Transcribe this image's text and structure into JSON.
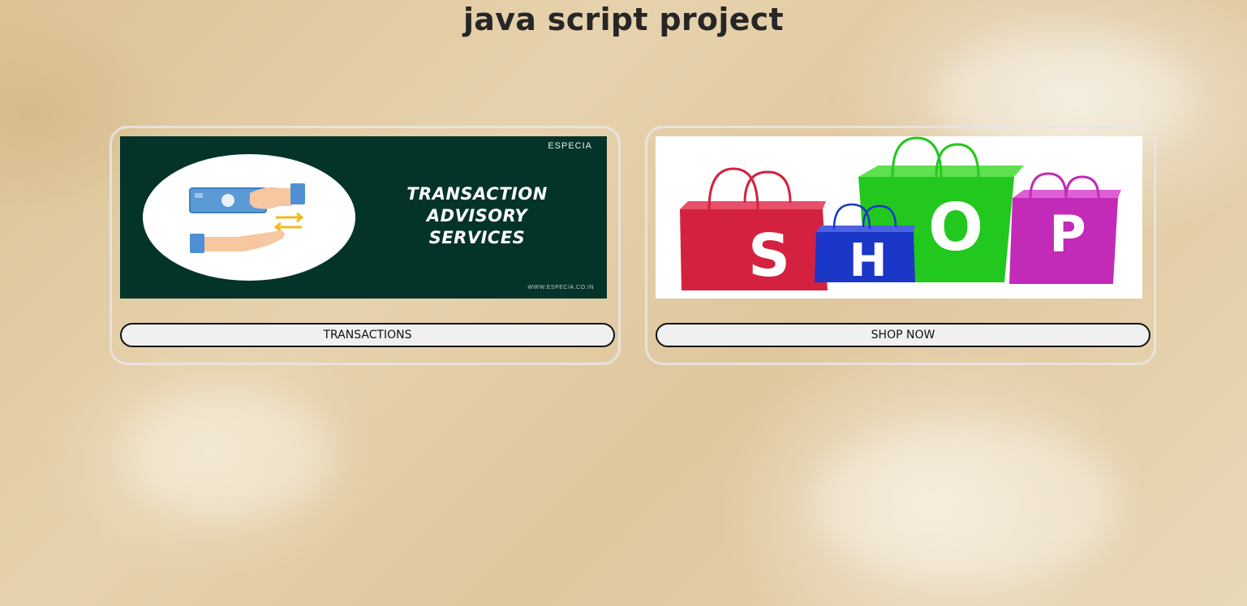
{
  "page": {
    "title": "java script project"
  },
  "cards": [
    {
      "image": {
        "logo": "ESPECIA",
        "heading_lines": [
          "TRANSACTION",
          "ADVISORY",
          "SERVICES"
        ],
        "website": "WWW.ESPECIA.CO.IN"
      },
      "button_label": "TRANSACTIONS"
    },
    {
      "image": {
        "bag_letters": [
          "S",
          "H",
          "O",
          "P"
        ]
      },
      "button_label": "SHOP NOW"
    }
  ],
  "colors": {
    "title_text": "#262626",
    "card_border": "#e8e4e2",
    "button_bg": "#f0f0f0",
    "transaction_bg": "#04332a",
    "bag_red": "#d4213f",
    "bag_blue": "#1b37c8",
    "bag_green": "#22c81e",
    "bag_magenta": "#c22ab8"
  }
}
